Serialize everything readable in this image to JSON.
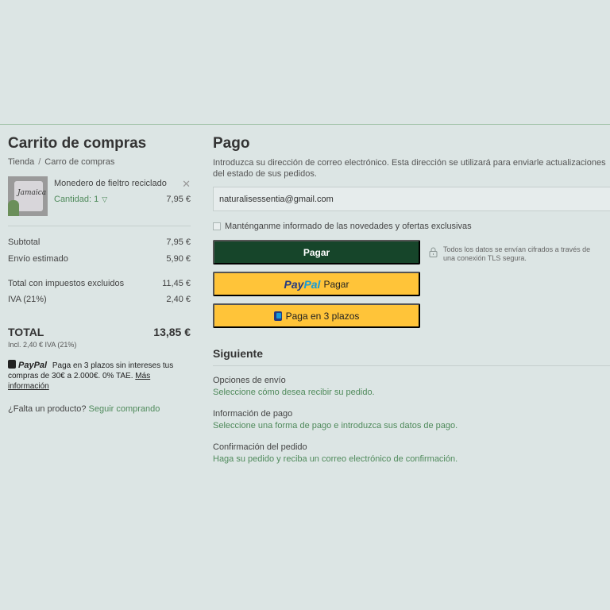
{
  "cart": {
    "title": "Carrito de compras",
    "breadcrumb": [
      "Tienda",
      "Carro de compras"
    ],
    "item": {
      "name": "Monedero de fieltro reciclado",
      "image_text": "Jamaica",
      "quantity_label": "Cantidad: 1",
      "price": "7,95 €"
    },
    "rows": {
      "subtotal": {
        "label": "Subtotal",
        "value": "7,95 €"
      },
      "envio": {
        "label": "Envío estimado",
        "value": "5,90 €"
      },
      "total_ex": {
        "label": "Total con impuestos excluidos",
        "value": "11,45 €"
      },
      "iva": {
        "label": "IVA (21%)",
        "value": "2,40 €"
      }
    },
    "total": {
      "label": "TOTAL",
      "value": "13,85 €",
      "sub": "Incl. 2,40 € IVA (21%)"
    },
    "paypal_note": {
      "logo": "PayPal",
      "text": "Paga en 3 plazos sin intereses tus compras de 30€ a 2.000€. 0% TAE.",
      "link": "Más información"
    },
    "missing": {
      "text": "¿Falta un producto?",
      "link": "Seguir comprando"
    }
  },
  "payment": {
    "title": "Pago",
    "intro": "Introduzca su dirección de correo electrónico. Esta dirección se utilizará para enviarle actualizaciones del estado de sus pedidos.",
    "email": "naturalisessentia@gmail.com",
    "newsletter_label": "Manténganme informado de las novedades y ofertas exclusivas",
    "pay_button": "Pagar",
    "secure_text": "Todos los datos se envían cifrados a través de una conexión TLS segura.",
    "paypal_button": {
      "logo_a": "Pay",
      "logo_b": "Pal",
      "label": "Pagar"
    },
    "plazos_button": "Paga en 3 plazos"
  },
  "next": {
    "title": "Siguiente",
    "steps": [
      {
        "title": "Opciones de envío",
        "desc": "Seleccione cómo desea recibir su pedido."
      },
      {
        "title": "Información de pago",
        "desc": "Seleccione una forma de pago e introduzca sus datos de pago."
      },
      {
        "title": "Confirmación del pedido",
        "desc": "Haga su pedido y reciba un correo electrónico de confirmación."
      }
    ]
  },
  "colors": {
    "background": "#dce5e4",
    "accent_green": "#4f8a5b",
    "pay_button": "#16452a",
    "paypal_yellow": "#ffc439"
  },
  "icons": [
    "close-icon",
    "chevron-down-icon",
    "lock-icon",
    "paypal-icon"
  ]
}
